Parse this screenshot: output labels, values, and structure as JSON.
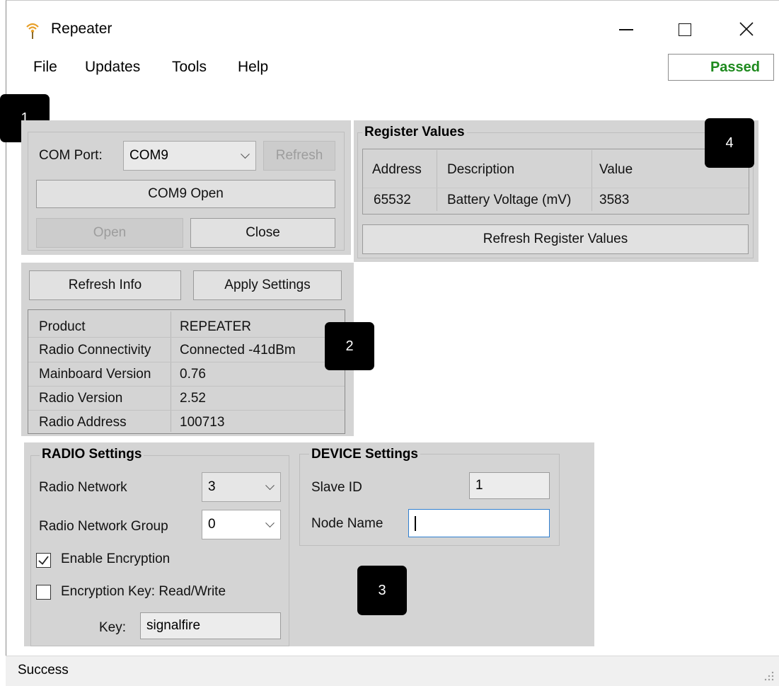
{
  "window": {
    "title": "Repeater",
    "minimize_glyph": "—",
    "maximize_glyph": "☐",
    "close_glyph": "✕"
  },
  "menu": [
    "File",
    "Updates",
    "Tools",
    "Help"
  ],
  "status_badge": {
    "text": "Passed",
    "color": "#1e8a1e"
  },
  "callouts": [
    "1",
    "2",
    "3",
    "4"
  ],
  "com": {
    "port_label": "COM Port:",
    "port_value": "COM9",
    "refresh_label": "Refresh",
    "status_button": "COM9 Open",
    "open_label": "Open",
    "close_label": "Close"
  },
  "registers": {
    "title": "Register Values",
    "headers": [
      "Address",
      "Description",
      "Value"
    ],
    "rows": [
      [
        "65532",
        "Battery Voltage (mV)",
        "3583"
      ]
    ],
    "refresh_label": "Refresh Register Values"
  },
  "info": {
    "refresh_label": "Refresh Info",
    "apply_label": "Apply Settings",
    "rows": [
      [
        "Product",
        "REPEATER"
      ],
      [
        "Radio Connectivity",
        "Connected -41dBm"
      ],
      [
        "Mainboard Version",
        "0.76"
      ],
      [
        "Radio Version",
        "2.52"
      ],
      [
        "Radio Address",
        "100713"
      ]
    ]
  },
  "radio": {
    "title": "RADIO Settings",
    "network_label": "Radio Network",
    "network_value": "3",
    "group_label": "Radio Network Group",
    "group_value": "0",
    "enc_label": "Enable Encryption",
    "enc_checked": true,
    "key_rw_label": "Encryption Key: Read/Write",
    "key_rw_checked": false,
    "key_label": "Key:",
    "key_value": "signalfire"
  },
  "device": {
    "title": "DEVICE Settings",
    "slave_label": "Slave ID",
    "slave_value": "1",
    "node_label": "Node Name",
    "node_value": ""
  },
  "status_bar": {
    "text": "Success"
  }
}
